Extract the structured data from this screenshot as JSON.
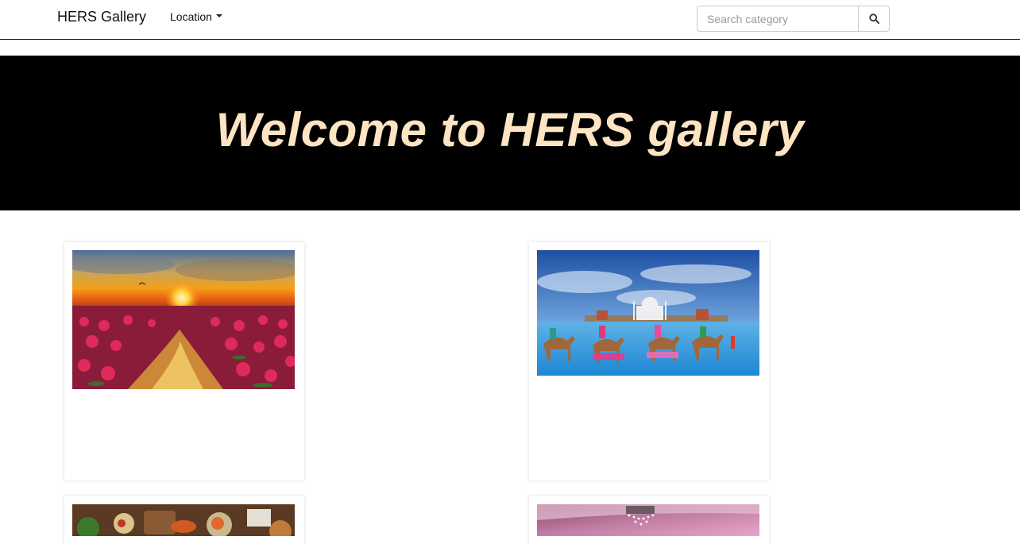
{
  "navbar": {
    "brand": "HERS Gallery",
    "location_label": "Location",
    "search": {
      "placeholder": "Search category",
      "value": ""
    },
    "search_icon": "search-icon"
  },
  "hero": {
    "title": "Welcome to HERS gallery",
    "background": "#000000",
    "title_color": "#fde4c2"
  },
  "gallery": {
    "images": [
      {
        "subject": "sunset over lotus lake"
      },
      {
        "subject": "camels in water before Taj Mahal"
      },
      {
        "subject": "food spread"
      },
      {
        "subject": "pink ceiling with chandelier"
      }
    ]
  }
}
